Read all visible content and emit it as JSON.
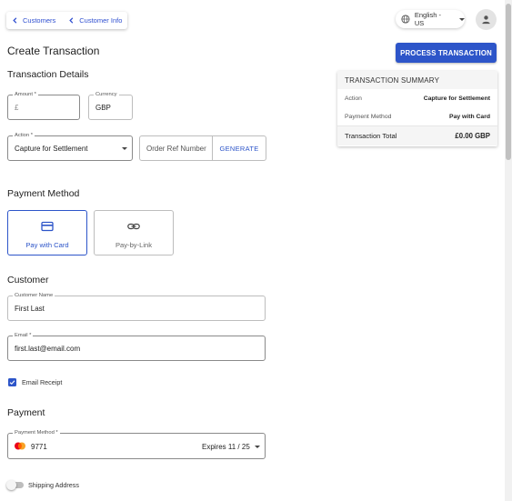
{
  "breadcrumb": {
    "items": [
      "Customers",
      "Customer Info"
    ]
  },
  "header": {
    "language": "English - US"
  },
  "page": {
    "title": "Create Transaction"
  },
  "process_button": "PROCESS TRANSACTION",
  "sections": {
    "details": "Transaction Details",
    "payment_method": "Payment Method",
    "customer": "Customer",
    "payment": "Payment"
  },
  "fields": {
    "amount": {
      "label": "Amount *",
      "value": "£"
    },
    "currency": {
      "label": "Currency",
      "value": "GBP"
    },
    "action": {
      "label": "Action *",
      "value": "Capture for Settlement"
    },
    "order_ref": {
      "placeholder": "Order Ref Number"
    },
    "generate": "GENERATE",
    "customer_name": {
      "label": "Customer Name",
      "value": "First Last"
    },
    "email": {
      "label": "Email *",
      "value": "first.last@email.com"
    },
    "payment_method": {
      "label": "Payment Method *",
      "card_last4": "9771",
      "expires": "Expires 11 / 25"
    }
  },
  "payment_options": [
    {
      "label": "Pay with Card",
      "icon": "credit-card-icon",
      "selected": true
    },
    {
      "label": "Pay-by-Link",
      "icon": "link-icon",
      "selected": false
    }
  ],
  "email_receipt": {
    "label": "Email Receipt",
    "checked": true
  },
  "shipping": {
    "label": "Shipping Address",
    "enabled": false
  },
  "summary": {
    "title": "TRANSACTION SUMMARY",
    "rows": [
      {
        "label": "Action",
        "value": "Capture for Settlement"
      },
      {
        "label": "Payment Method",
        "value": "Pay with Card"
      }
    ],
    "total": {
      "label": "Transaction Total",
      "value": "£0.00 GBP"
    }
  },
  "colors": {
    "primary": "#2d55c9"
  }
}
